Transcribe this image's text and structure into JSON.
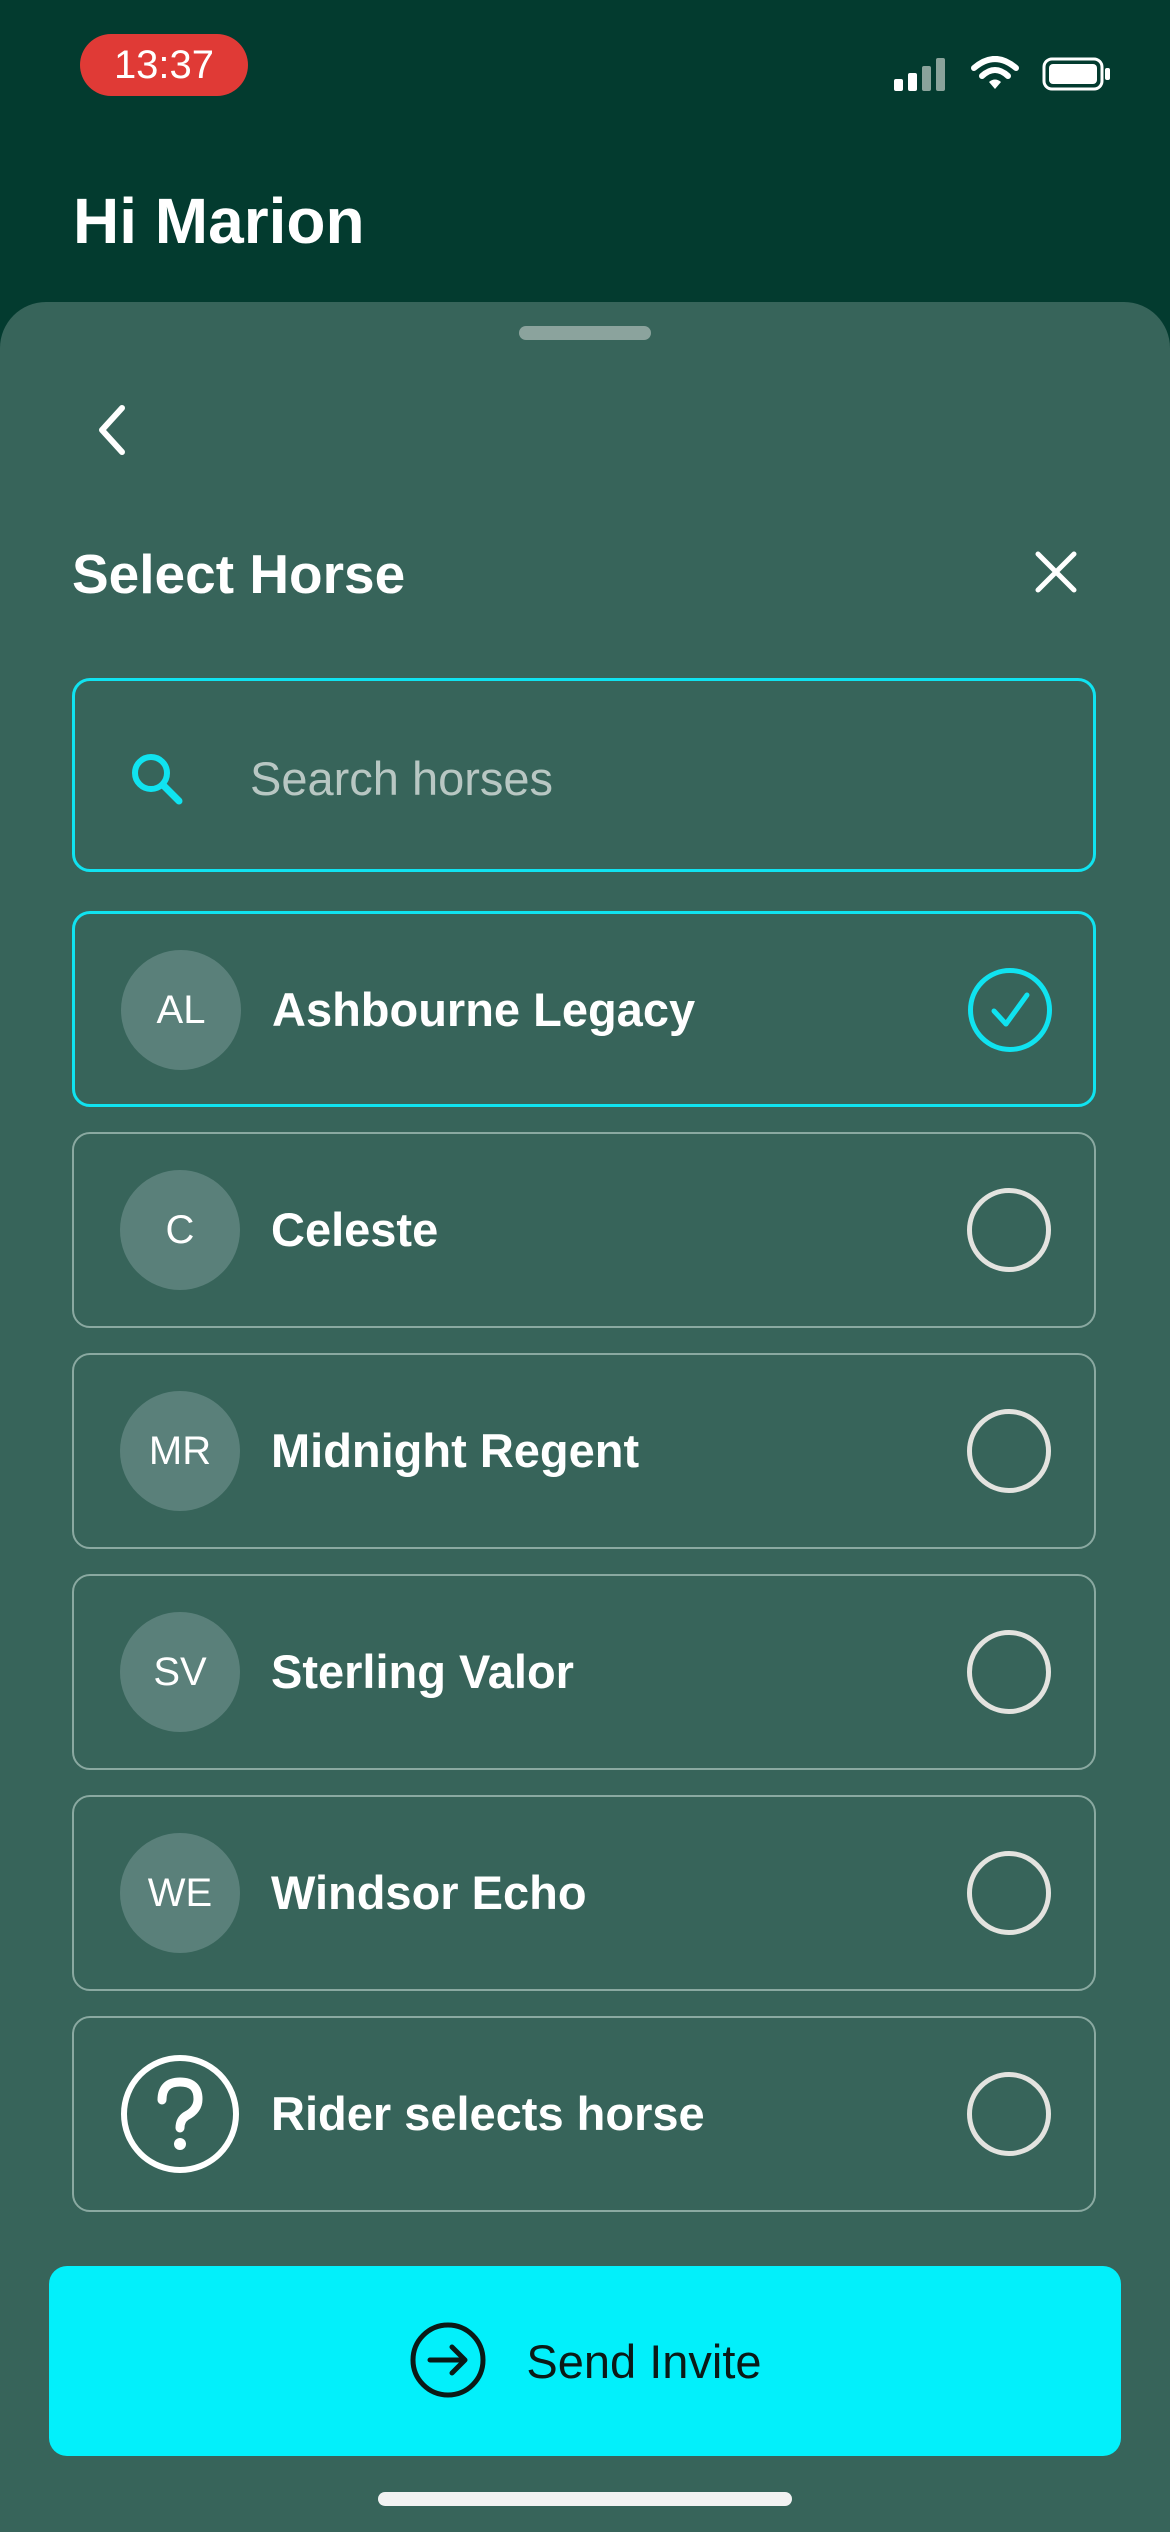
{
  "status_bar": {
    "time": "13:37"
  },
  "header": {
    "greeting": "Hi Marion"
  },
  "sheet": {
    "title": "Select Horse",
    "search": {
      "placeholder": "Search horses",
      "value": ""
    },
    "horses": [
      {
        "initials": "AL",
        "name": "Ashbourne Legacy",
        "selected": true
      },
      {
        "initials": "C",
        "name": "Celeste",
        "selected": false
      },
      {
        "initials": "MR",
        "name": "Midnight Regent",
        "selected": false
      },
      {
        "initials": "SV",
        "name": "Sterling Valor",
        "selected": false
      },
      {
        "initials": "WE",
        "name": "Windsor Echo",
        "selected": false
      },
      {
        "icon": "question-circle-icon",
        "name": "Rider selects horse",
        "selected": false
      }
    ],
    "send_button": {
      "label": "Send Invite",
      "icon": "arrow-right-circle-icon"
    }
  },
  "colors": {
    "header_bg": "#033b2f",
    "sheet_bg": "#37645a",
    "accent": "#10e3f0",
    "button_bg": "#02f0fb",
    "status_time_bg": "#e03a36"
  }
}
